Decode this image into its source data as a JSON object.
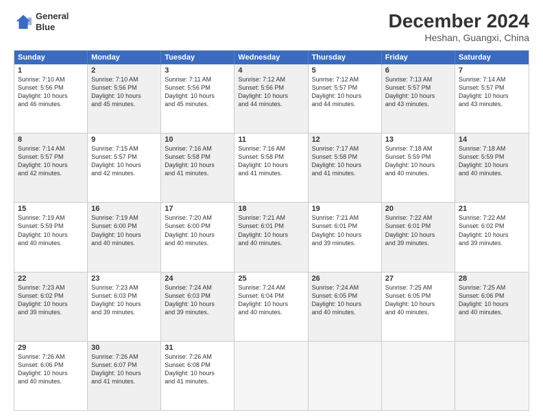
{
  "logo": {
    "line1": "General",
    "line2": "Blue"
  },
  "title": "December 2024",
  "location": "Heshan, Guangxi, China",
  "header_days": [
    "Sunday",
    "Monday",
    "Tuesday",
    "Wednesday",
    "Thursday",
    "Friday",
    "Saturday"
  ],
  "rows": [
    [
      {
        "day": "1",
        "lines": [
          "Sunrise: 7:10 AM",
          "Sunset: 5:56 PM",
          "Daylight: 10 hours",
          "and 46 minutes."
        ],
        "shade": false
      },
      {
        "day": "2",
        "lines": [
          "Sunrise: 7:10 AM",
          "Sunset: 5:56 PM",
          "Daylight: 10 hours",
          "and 45 minutes."
        ],
        "shade": true
      },
      {
        "day": "3",
        "lines": [
          "Sunrise: 7:11 AM",
          "Sunset: 5:56 PM",
          "Daylight: 10 hours",
          "and 45 minutes."
        ],
        "shade": false
      },
      {
        "day": "4",
        "lines": [
          "Sunrise: 7:12 AM",
          "Sunset: 5:56 PM",
          "Daylight: 10 hours",
          "and 44 minutes."
        ],
        "shade": true
      },
      {
        "day": "5",
        "lines": [
          "Sunrise: 7:12 AM",
          "Sunset: 5:57 PM",
          "Daylight: 10 hours",
          "and 44 minutes."
        ],
        "shade": false
      },
      {
        "day": "6",
        "lines": [
          "Sunrise: 7:13 AM",
          "Sunset: 5:57 PM",
          "Daylight: 10 hours",
          "and 43 minutes."
        ],
        "shade": true
      },
      {
        "day": "7",
        "lines": [
          "Sunrise: 7:14 AM",
          "Sunset: 5:57 PM",
          "Daylight: 10 hours",
          "and 43 minutes."
        ],
        "shade": false
      }
    ],
    [
      {
        "day": "8",
        "lines": [
          "Sunrise: 7:14 AM",
          "Sunset: 5:57 PM",
          "Daylight: 10 hours",
          "and 42 minutes."
        ],
        "shade": true
      },
      {
        "day": "9",
        "lines": [
          "Sunrise: 7:15 AM",
          "Sunset: 5:57 PM",
          "Daylight: 10 hours",
          "and 42 minutes."
        ],
        "shade": false
      },
      {
        "day": "10",
        "lines": [
          "Sunrise: 7:16 AM",
          "Sunset: 5:58 PM",
          "Daylight: 10 hours",
          "and 41 minutes."
        ],
        "shade": true
      },
      {
        "day": "11",
        "lines": [
          "Sunrise: 7:16 AM",
          "Sunset: 5:58 PM",
          "Daylight: 10 hours",
          "and 41 minutes."
        ],
        "shade": false
      },
      {
        "day": "12",
        "lines": [
          "Sunrise: 7:17 AM",
          "Sunset: 5:58 PM",
          "Daylight: 10 hours",
          "and 41 minutes."
        ],
        "shade": true
      },
      {
        "day": "13",
        "lines": [
          "Sunrise: 7:18 AM",
          "Sunset: 5:59 PM",
          "Daylight: 10 hours",
          "and 40 minutes."
        ],
        "shade": false
      },
      {
        "day": "14",
        "lines": [
          "Sunrise: 7:18 AM",
          "Sunset: 5:59 PM",
          "Daylight: 10 hours",
          "and 40 minutes."
        ],
        "shade": true
      }
    ],
    [
      {
        "day": "15",
        "lines": [
          "Sunrise: 7:19 AM",
          "Sunset: 5:59 PM",
          "Daylight: 10 hours",
          "and 40 minutes."
        ],
        "shade": false
      },
      {
        "day": "16",
        "lines": [
          "Sunrise: 7:19 AM",
          "Sunset: 6:00 PM",
          "Daylight: 10 hours",
          "and 40 minutes."
        ],
        "shade": true
      },
      {
        "day": "17",
        "lines": [
          "Sunrise: 7:20 AM",
          "Sunset: 6:00 PM",
          "Daylight: 10 hours",
          "and 40 minutes."
        ],
        "shade": false
      },
      {
        "day": "18",
        "lines": [
          "Sunrise: 7:21 AM",
          "Sunset: 6:01 PM",
          "Daylight: 10 hours",
          "and 40 minutes."
        ],
        "shade": true
      },
      {
        "day": "19",
        "lines": [
          "Sunrise: 7:21 AM",
          "Sunset: 6:01 PM",
          "Daylight: 10 hours",
          "and 39 minutes."
        ],
        "shade": false
      },
      {
        "day": "20",
        "lines": [
          "Sunrise: 7:22 AM",
          "Sunset: 6:01 PM",
          "Daylight: 10 hours",
          "and 39 minutes."
        ],
        "shade": true
      },
      {
        "day": "21",
        "lines": [
          "Sunrise: 7:22 AM",
          "Sunset: 6:02 PM",
          "Daylight: 10 hours",
          "and 39 minutes."
        ],
        "shade": false
      }
    ],
    [
      {
        "day": "22",
        "lines": [
          "Sunrise: 7:23 AM",
          "Sunset: 6:02 PM",
          "Daylight: 10 hours",
          "and 39 minutes."
        ],
        "shade": true
      },
      {
        "day": "23",
        "lines": [
          "Sunrise: 7:23 AM",
          "Sunset: 6:03 PM",
          "Daylight: 10 hours",
          "and 39 minutes."
        ],
        "shade": false
      },
      {
        "day": "24",
        "lines": [
          "Sunrise: 7:24 AM",
          "Sunset: 6:03 PM",
          "Daylight: 10 hours",
          "and 39 minutes."
        ],
        "shade": true
      },
      {
        "day": "25",
        "lines": [
          "Sunrise: 7:24 AM",
          "Sunset: 6:04 PM",
          "Daylight: 10 hours",
          "and 40 minutes."
        ],
        "shade": false
      },
      {
        "day": "26",
        "lines": [
          "Sunrise: 7:24 AM",
          "Sunset: 6:05 PM",
          "Daylight: 10 hours",
          "and 40 minutes."
        ],
        "shade": true
      },
      {
        "day": "27",
        "lines": [
          "Sunrise: 7:25 AM",
          "Sunset: 6:05 PM",
          "Daylight: 10 hours",
          "and 40 minutes."
        ],
        "shade": false
      },
      {
        "day": "28",
        "lines": [
          "Sunrise: 7:25 AM",
          "Sunset: 6:06 PM",
          "Daylight: 10 hours",
          "and 40 minutes."
        ],
        "shade": true
      }
    ],
    [
      {
        "day": "29",
        "lines": [
          "Sunrise: 7:26 AM",
          "Sunset: 6:06 PM",
          "Daylight: 10 hours",
          "and 40 minutes."
        ],
        "shade": false
      },
      {
        "day": "30",
        "lines": [
          "Sunrise: 7:26 AM",
          "Sunset: 6:07 PM",
          "Daylight: 10 hours",
          "and 41 minutes."
        ],
        "shade": true
      },
      {
        "day": "31",
        "lines": [
          "Sunrise: 7:26 AM",
          "Sunset: 6:08 PM",
          "Daylight: 10 hours",
          "and 41 minutes."
        ],
        "shade": false
      },
      {
        "day": "",
        "lines": [],
        "shade": true,
        "empty": true
      },
      {
        "day": "",
        "lines": [],
        "shade": true,
        "empty": true
      },
      {
        "day": "",
        "lines": [],
        "shade": true,
        "empty": true
      },
      {
        "day": "",
        "lines": [],
        "shade": true,
        "empty": true
      }
    ]
  ]
}
